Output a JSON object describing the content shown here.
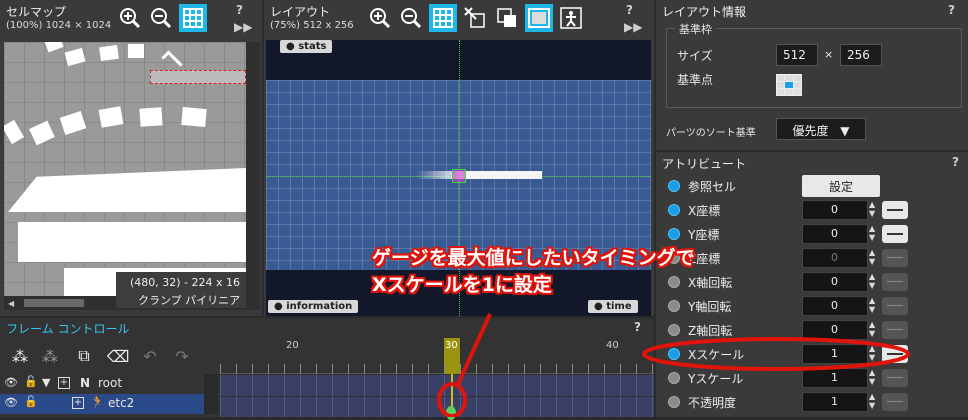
{
  "cellmap": {
    "title": "セルマップ",
    "info": "(100%) 1024 × 1024",
    "coords": "(480, 32) - 224 x 16",
    "cell_name": "クランプ  パイリニア"
  },
  "layout": {
    "title": "レイアウト",
    "info": "(75%) 512 x 256",
    "tag_stats": "stats",
    "tag_information": "information",
    "tag_time": "time"
  },
  "layout_info": {
    "title": "レイアウト情報",
    "group_label": "基準枠",
    "size_label": "サイズ",
    "width": "512",
    "times": "×",
    "height": "256",
    "origin_label": "基準点",
    "sort_label": "パーツのソート基準",
    "sort_value": "優先度"
  },
  "attributes": {
    "title": "アトリビュート",
    "help": "?",
    "rows": [
      {
        "label": "参照セル",
        "value": "設定",
        "active": true
      },
      {
        "label": "X座標",
        "value": "0",
        "active": true
      },
      {
        "label": "Y座標",
        "value": "0",
        "active": true
      },
      {
        "label": "Z座標",
        "value": "0",
        "active": false
      },
      {
        "label": "X軸回転",
        "value": "0",
        "active": false
      },
      {
        "label": "Y軸回転",
        "value": "0",
        "active": false
      },
      {
        "label": "Z軸回転",
        "value": "0",
        "active": false
      },
      {
        "label": "Xスケール",
        "value": "1",
        "active": true
      },
      {
        "label": "Yスケール",
        "value": "1",
        "active": false
      },
      {
        "label": "不透明度",
        "value": "1",
        "active": false
      }
    ]
  },
  "frame_control": {
    "title": "フレーム コントロール",
    "ruler": [
      "20",
      "30",
      "40"
    ],
    "tracks": [
      {
        "label": "root",
        "type": "N"
      },
      {
        "label": "etc2",
        "type": "part"
      }
    ]
  },
  "annotation": {
    "line1": "ゲージを最大値にしたいタイミングで",
    "line2": "Xスケールを1に設定"
  },
  "colors": {
    "accent": "#1fb8e6",
    "annotation_red": "#e0140a",
    "layout_blue": "#3a5a94"
  }
}
